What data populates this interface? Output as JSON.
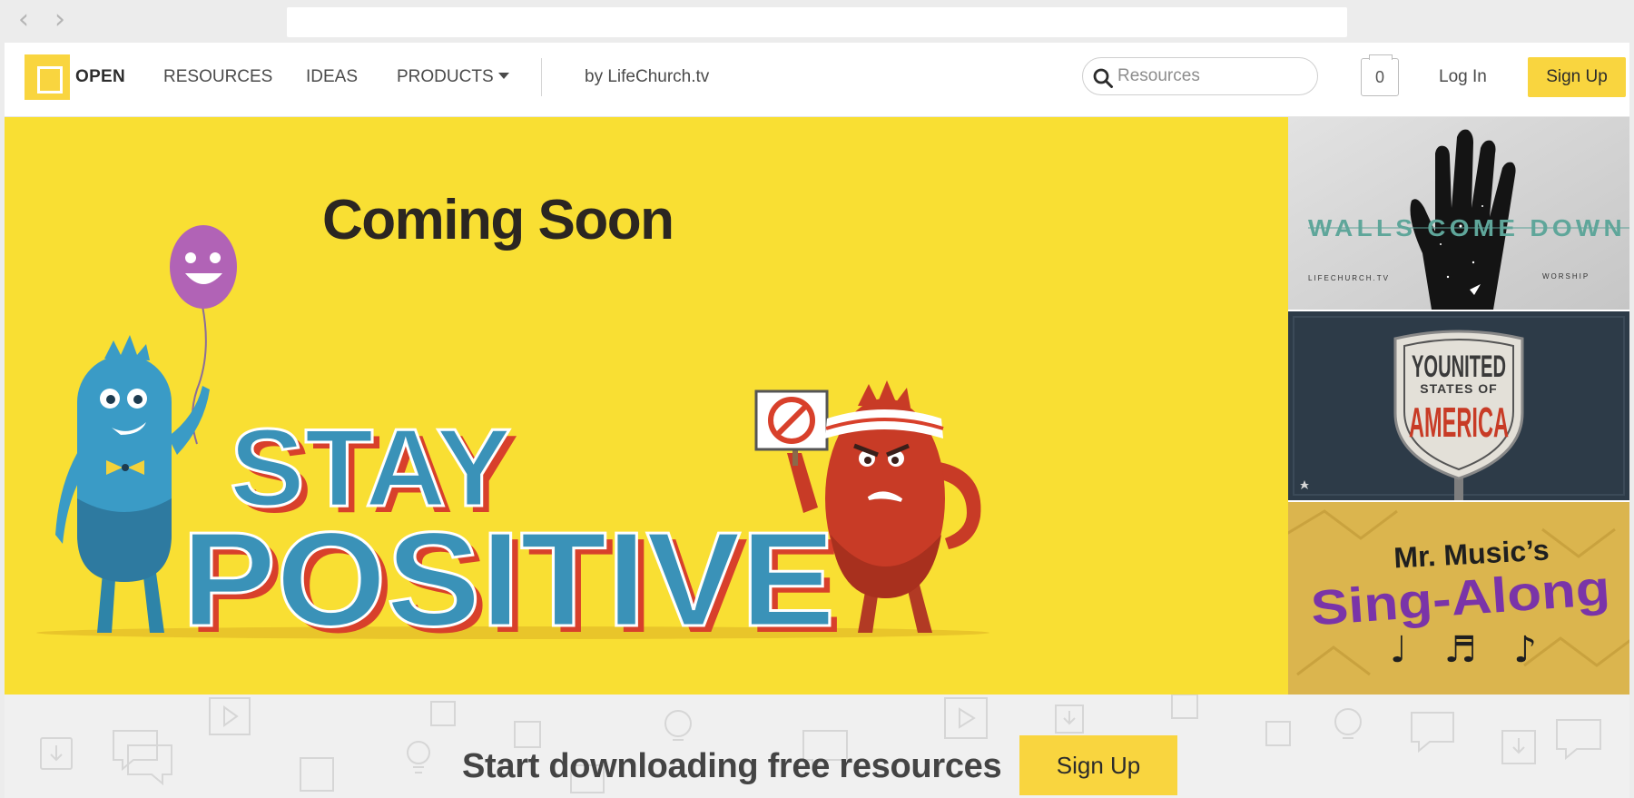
{
  "browser": {
    "back_glyph": "‹",
    "forward_glyph": "›"
  },
  "header": {
    "logo_text": "OPEN",
    "nav": {
      "resources": "RESOURCES",
      "ideas": "IDEAS",
      "products": "PRODUCTS"
    },
    "byline": "by LifeChurch.tv",
    "search": {
      "value": "",
      "placeholder": "Resources",
      "icon": "search-icon"
    },
    "cart_count": "0",
    "login": "Log In",
    "signup": "Sign Up"
  },
  "hero": {
    "title": "Coming Soon",
    "art_line1": "STAY",
    "art_line2": "POSITIVE",
    "background": "#f9df33"
  },
  "side_panels": {
    "walls": {
      "title": "WALLS COME DOWN",
      "left_caption": "LIFECHURCH.TV",
      "right_caption": "WORSHIP"
    },
    "younited": {
      "line1": "YOUNITED",
      "line2": "STATES OF",
      "line3": "AMERICA"
    },
    "music": {
      "line1": "Mr. Music’s",
      "line2": "Sing-Along",
      "notes": "♩ ♬ ♪"
    }
  },
  "band": {
    "text": "Start downloading free resources",
    "signup": "Sign Up"
  },
  "colors": {
    "brand_yellow": "#f9d53f",
    "text_dark": "#2b2621"
  }
}
